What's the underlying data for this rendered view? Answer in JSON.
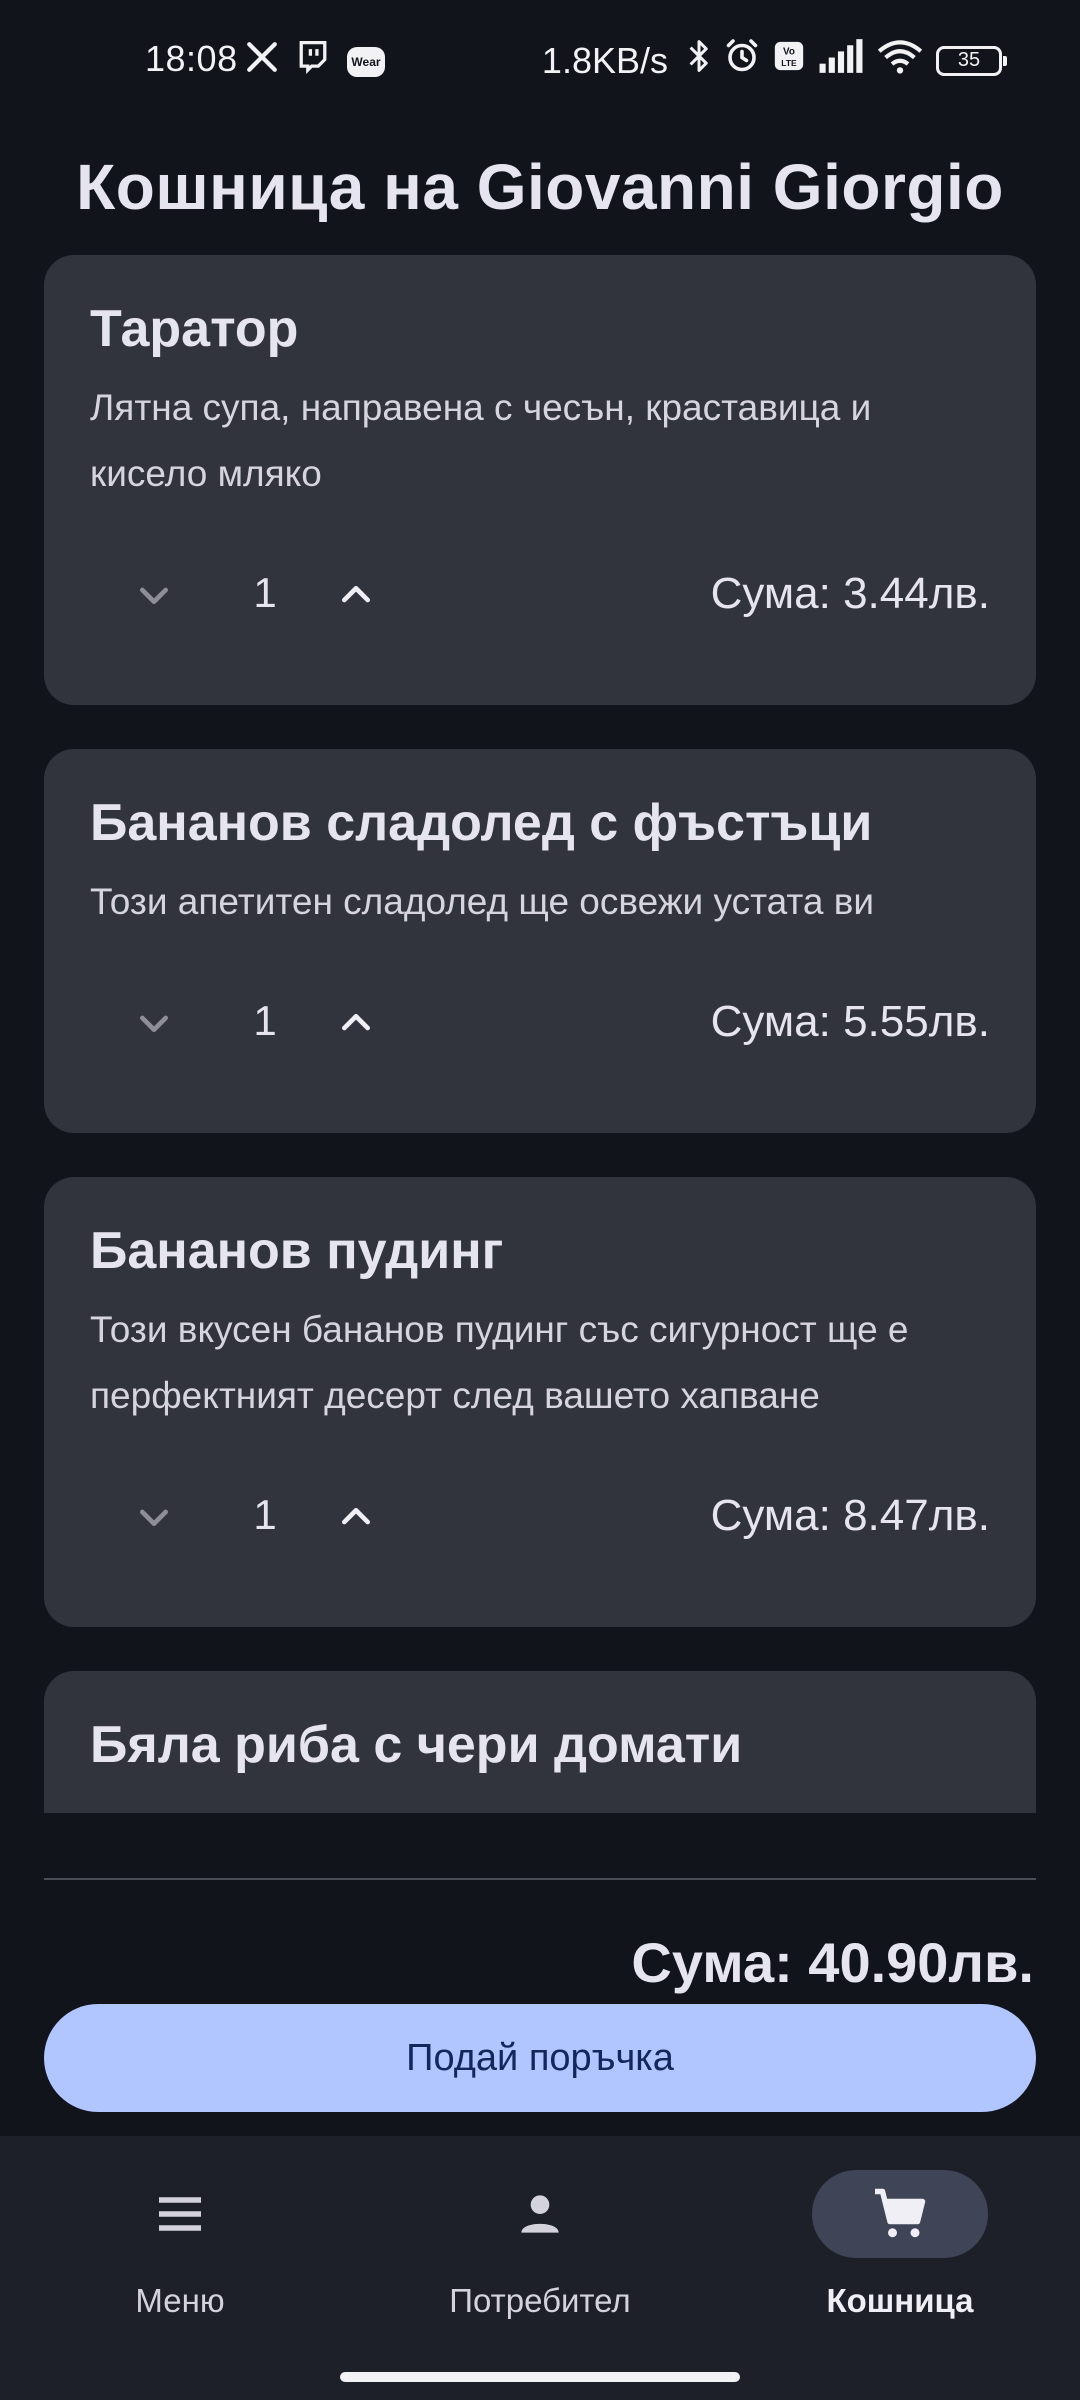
{
  "status_bar": {
    "time": "18:08",
    "left_icons": [
      "x-icon",
      "twitch-icon",
      "wear-icon"
    ],
    "wear_label": "Wear",
    "speed": "1.8KB/s",
    "right_icons": [
      "bluetooth-icon",
      "alarm-icon",
      "volte-icon",
      "signal-icon",
      "wifi-icon"
    ],
    "battery": "35"
  },
  "title": "Кошница на Giovanni Giorgio",
  "items": [
    {
      "name": "Таратор",
      "description": "Лятна супа, направена с чесън, краставица и кисело мляко",
      "quantity": "1",
      "sum": "Сума: 3.44лв."
    },
    {
      "name": "Бананов сладолед с фъстъци",
      "description": "Този апетитен сладолед ще освежи устата ви",
      "quantity": "1",
      "sum": "Сума: 5.55лв."
    },
    {
      "name": "Бананов пудинг",
      "description": "Този вкусен бананов пудинг със сигурност ще е перфектният десерт след вашето хапване",
      "quantity": "1",
      "sum": "Сума: 8.47лв."
    },
    {
      "name": "Бяла риба с чери домати"
    }
  ],
  "total": "Сума: 40.90лв.",
  "order_button": "Подай поръчка",
  "nav": [
    {
      "label": "Меню",
      "icon": "menu-icon",
      "active": false
    },
    {
      "label": "Потребител",
      "icon": "person-icon",
      "active": false
    },
    {
      "label": "Кошница",
      "icon": "cart-icon",
      "active": true
    }
  ],
  "colors": {
    "background": "#11141b",
    "card": "#31333d",
    "accent": "#b1c5ff",
    "nav_background": "#1d2029",
    "nav_active_pill": "#3f4557"
  }
}
